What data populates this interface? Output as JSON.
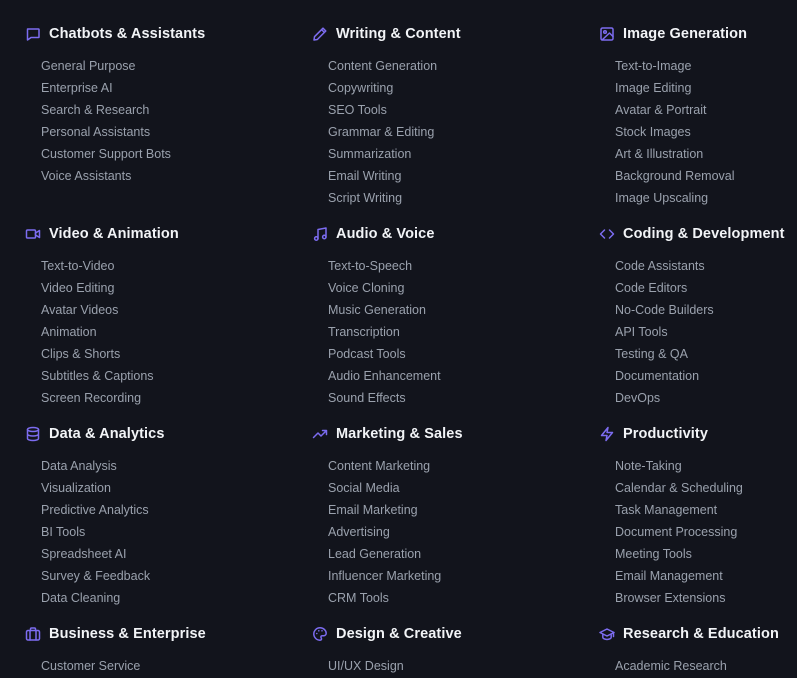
{
  "colors": {
    "background": "#12141c",
    "accent": "#7c6cf0",
    "title": "#f2f4f7",
    "item": "#9aa1ad"
  },
  "categories": [
    {
      "icon": "chat-bubble-icon",
      "title": "Chatbots & Assistants",
      "items": [
        "General Purpose",
        "Enterprise AI",
        "Search & Research",
        "Personal Assistants",
        "Customer Support Bots",
        "Voice Assistants"
      ]
    },
    {
      "icon": "pencil-icon",
      "title": "Writing & Content",
      "items": [
        "Content Generation",
        "Copywriting",
        "SEO Tools",
        "Grammar & Editing",
        "Summarization",
        "Email Writing",
        "Script Writing"
      ]
    },
    {
      "icon": "image-icon",
      "title": "Image Generation",
      "items": [
        "Text-to-Image",
        "Image Editing",
        "Avatar & Portrait",
        "Stock Images",
        "Art & Illustration",
        "Background Removal",
        "Image Upscaling"
      ]
    },
    {
      "icon": "video-camera-icon",
      "title": "Video & Animation",
      "items": [
        "Text-to-Video",
        "Video Editing",
        "Avatar Videos",
        "Animation",
        "Clips & Shorts",
        "Subtitles & Captions",
        "Screen Recording"
      ]
    },
    {
      "icon": "music-note-icon",
      "title": "Audio & Voice",
      "items": [
        "Text-to-Speech",
        "Voice Cloning",
        "Music Generation",
        "Transcription",
        "Podcast Tools",
        "Audio Enhancement",
        "Sound Effects"
      ]
    },
    {
      "icon": "code-brackets-icon",
      "title": "Coding & Development",
      "items": [
        "Code Assistants",
        "Code Editors",
        "No-Code Builders",
        "API Tools",
        "Testing & QA",
        "Documentation",
        "DevOps"
      ]
    },
    {
      "icon": "database-icon",
      "title": "Data & Analytics",
      "items": [
        "Data Analysis",
        "Visualization",
        "Predictive Analytics",
        "BI Tools",
        "Spreadsheet AI",
        "Survey & Feedback",
        "Data Cleaning"
      ]
    },
    {
      "icon": "trending-up-icon",
      "title": "Marketing & Sales",
      "items": [
        "Content Marketing",
        "Social Media",
        "Email Marketing",
        "Advertising",
        "Lead Generation",
        "Influencer Marketing",
        "CRM Tools"
      ]
    },
    {
      "icon": "lightning-bolt-icon",
      "title": "Productivity",
      "items": [
        "Note-Taking",
        "Calendar & Scheduling",
        "Task Management",
        "Document Processing",
        "Meeting Tools",
        "Email Management",
        "Browser Extensions"
      ]
    },
    {
      "icon": "briefcase-icon",
      "title": "Business & Enterprise",
      "items": [
        "Customer Service"
      ]
    },
    {
      "icon": "palette-icon",
      "title": "Design & Creative",
      "items": [
        "UI/UX Design"
      ]
    },
    {
      "icon": "graduation-cap-icon",
      "title": "Research & Education",
      "items": [
        "Academic Research"
      ]
    }
  ]
}
